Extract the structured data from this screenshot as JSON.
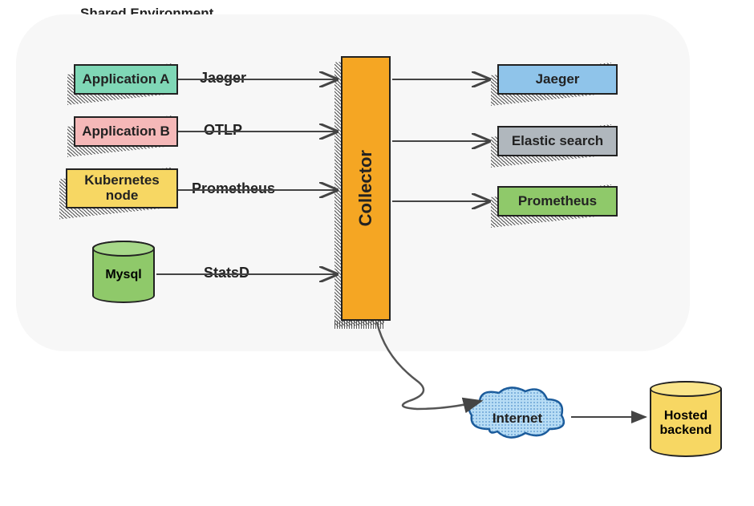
{
  "diagram": {
    "title": "Shared Environment",
    "sources": [
      {
        "label": "Application A",
        "color": "#7fd7b6",
        "protocol": "Jaeger"
      },
      {
        "label": "Application B",
        "color": "#f5b8b8",
        "protocol": "OTLP"
      },
      {
        "label": "Kubernetes node",
        "color": "#f7d763",
        "protocol": "Prometheus"
      },
      {
        "label": "Mysql",
        "color": "#8fc96a",
        "protocol": "StatsD",
        "shape": "cylinder"
      }
    ],
    "collector": {
      "label": "Collector",
      "color": "#f5a623"
    },
    "sinks": [
      {
        "label": "Jaeger",
        "color": "#8fc4ea"
      },
      {
        "label": "Elastic search",
        "color": "#b0b7bd"
      },
      {
        "label": "Prometheus",
        "color": "#8fc96a"
      }
    ],
    "internet": {
      "label": "Internet"
    },
    "hosted": {
      "label": "Hosted backend",
      "color": "#f7d763"
    }
  }
}
